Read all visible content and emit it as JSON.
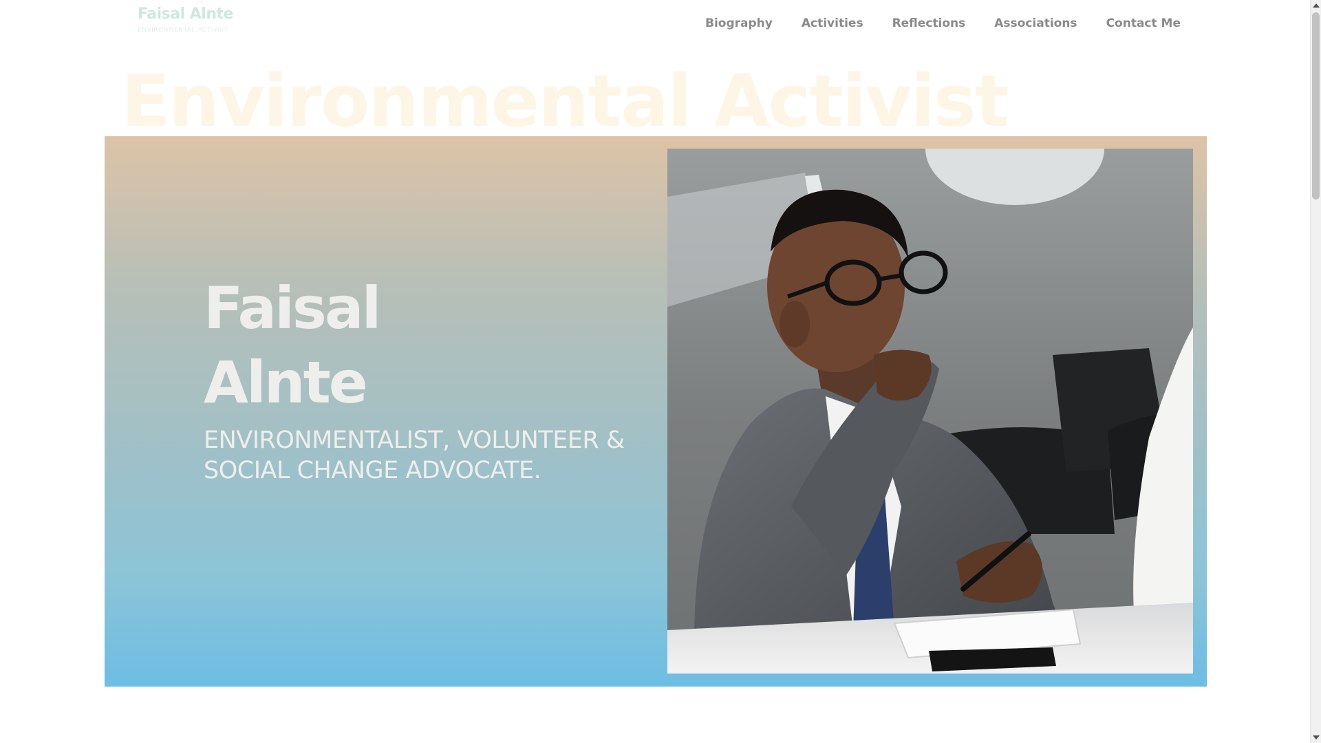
{
  "logo": {
    "name": "Faisal Alnte",
    "tagline": "ENVIRONMENTAL ACTIVIST"
  },
  "nav": {
    "items": [
      {
        "label": "Biography"
      },
      {
        "label": "Activities"
      },
      {
        "label": "Reflections"
      },
      {
        "label": "Associations"
      },
      {
        "label": "Contact Me"
      }
    ]
  },
  "background_heading": "Environmental Activist",
  "hero": {
    "name_line1": "Faisal",
    "name_line2": "Alnte",
    "subtitle": "ENVIRONMENTALIST, VOLUNTEER & SOCIAL CHANGE ADVOCATE.",
    "gradient_colors": [
      "#ddc3a7",
      "#b6bfb8",
      "#a2c0c6",
      "#8cc4d7",
      "#6dbde4"
    ]
  },
  "colors": {
    "nav_text": "#8a8a8a",
    "heading_ghost": "#fdf6e6",
    "hero_text": "#eeeeec"
  }
}
